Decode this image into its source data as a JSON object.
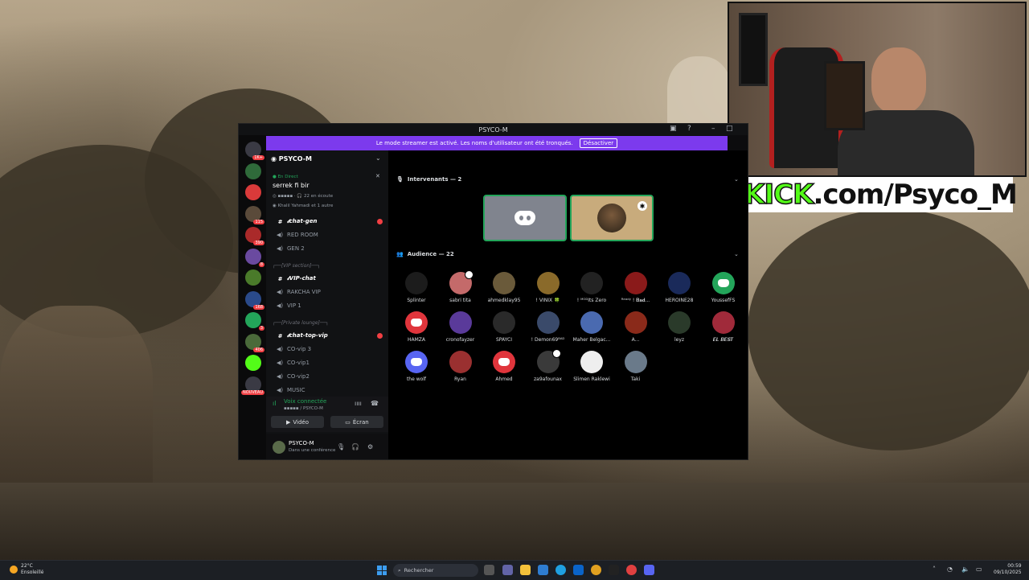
{
  "window": {
    "title": "PSYCO-M",
    "streamer_notice": "Le mode streamer est activé. Les noms d'utilisateur ont été tronqués.",
    "disable_button": "Désactiver"
  },
  "overlay": {
    "kick_part": "KICK",
    "domain_part": ".com/Psyco_M"
  },
  "server_list": [
    {
      "badge": "1K+"
    },
    {
      "badge": ""
    },
    {
      "badge": ""
    },
    {
      "badge": "115"
    },
    {
      "badge": "390"
    },
    {
      "badge": "8"
    },
    {
      "badge": ""
    },
    {
      "badge": "168"
    },
    {
      "badge": "3"
    },
    {
      "badge": "406"
    },
    {
      "badge": ""
    },
    {
      "badge": "NOUVEAU"
    }
  ],
  "sidebar": {
    "server_name": "PSYCO-M",
    "live_label": "En Direct",
    "stage_title": "serrek fi bir",
    "stage_listeners": "22 en écoute",
    "stage_speakers": "Khalil Yahmadi et 1 autre",
    "channels": [
      {
        "icon": "#",
        "label": "𝓽chat-gen",
        "bold": true,
        "unread": true
      },
      {
        "icon": "🔊",
        "label": "RED ROOM",
        "bold": false,
        "unread": false
      },
      {
        "icon": "🔊",
        "label": "GEN 2",
        "bold": false,
        "unread": false
      }
    ],
    "category_vip": "┌──[VIP section]──┐",
    "channels_vip": [
      {
        "icon": "#",
        "label": "𝓽VIP-chat",
        "bold": true,
        "unread": false
      },
      {
        "icon": "🔊",
        "label": "RAKCHA VIP",
        "bold": false,
        "unread": false
      },
      {
        "icon": "🔊",
        "label": "VIP 1",
        "bold": false,
        "unread": false
      }
    ],
    "category_private": "┌──[Private lounge]──┐",
    "channels_private": [
      {
        "icon": "#",
        "label": "𝓽chat-top-vip",
        "bold": true,
        "unread": true
      },
      {
        "icon": "🔊",
        "label": "CO-vip 3",
        "bold": false,
        "unread": false
      },
      {
        "icon": "🔊",
        "label": "CO-vip1",
        "bold": false,
        "unread": false
      },
      {
        "icon": "🔊",
        "label": "CO-vip2",
        "bold": false,
        "unread": false
      },
      {
        "icon": "🔊",
        "label": "MUSIC",
        "bold": false,
        "unread": false
      }
    ],
    "voice": {
      "title": "Voix connectée",
      "sub": "PSYCO-M",
      "video": "Vidéo",
      "screen": "Écran"
    },
    "user": {
      "name": "PSYCO-M",
      "status": "Dans une conférence"
    }
  },
  "stage": {
    "speakers_header": "Intervenants — 2",
    "audience_header": "Audience — 22",
    "audience": [
      {
        "name": "Splinter",
        "color": "#1c1c1c"
      },
      {
        "name": "sabri tita",
        "color": "#c46a6a"
      },
      {
        "name": "ahmedklay95",
        "color": "#6a5a3a"
      },
      {
        "name": "! VINIX 🍀",
        "color": "#8a6a2a"
      },
      {
        "name": "! ᴹᴼᴰIts Zero",
        "color": "#222"
      },
      {
        "name": "ᴿᵉᵃᵈʸ ! 𝐁𝐚𝐝...",
        "color": "#8a1a1a"
      },
      {
        "name": "HEROINE28",
        "color": "#1a2a5a"
      },
      {
        "name": "YoussefFS",
        "color": "#23a55a"
      },
      {
        "name": "HAMZA",
        "color": "#e0353c"
      },
      {
        "name": "cronofayzer",
        "color": "#5a3a9a"
      },
      {
        "name": "SPAYCI",
        "color": "#2a2a2a"
      },
      {
        "name": "! Demon69ᴮᴬᴰ",
        "color": "#3a4a6a"
      },
      {
        "name": "Maher Belgac...",
        "color": "#4a6ab0"
      },
      {
        "name": "A...",
        "color": "#8a2a1a"
      },
      {
        "name": "leyz",
        "color": "#2a3a2a"
      },
      {
        "name": "𝑬𝑳 𝑩𝑬𝑺𝑻",
        "color": "#a02a3a"
      },
      {
        "name": "the wolf",
        "color": "#5865f2"
      },
      {
        "name": "Ryan",
        "color": "#9a3030"
      },
      {
        "name": "Ahmed",
        "color": "#e0353c"
      },
      {
        "name": "za9afounax",
        "color": "#3a3a3a"
      },
      {
        "name": "Slimen Raklewi",
        "color": "#eeeeee"
      },
      {
        "name": "Taki",
        "color": "#6a7a8a"
      }
    ]
  },
  "taskbar": {
    "temp": "22°C",
    "weather": "Ensoleillé",
    "search": "Rechercher",
    "time": "00:59",
    "date": "09/10/2025"
  }
}
